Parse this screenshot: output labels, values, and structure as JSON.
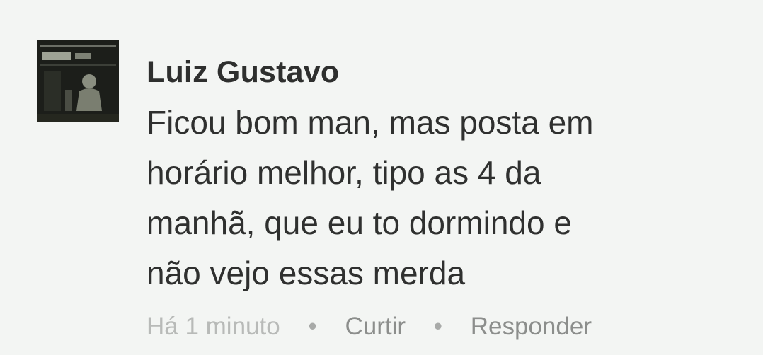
{
  "comment": {
    "author": "Luiz Gustavo",
    "lines": [
      "Ficou bom man, mas posta em",
      "horário melhor, tipo as 4 da",
      "manhã, que eu to dormindo e",
      "não vejo essas merda"
    ],
    "timestamp": "Há 1 minuto",
    "separator": "•",
    "like_label": "Curtir",
    "reply_label": "Responder"
  }
}
